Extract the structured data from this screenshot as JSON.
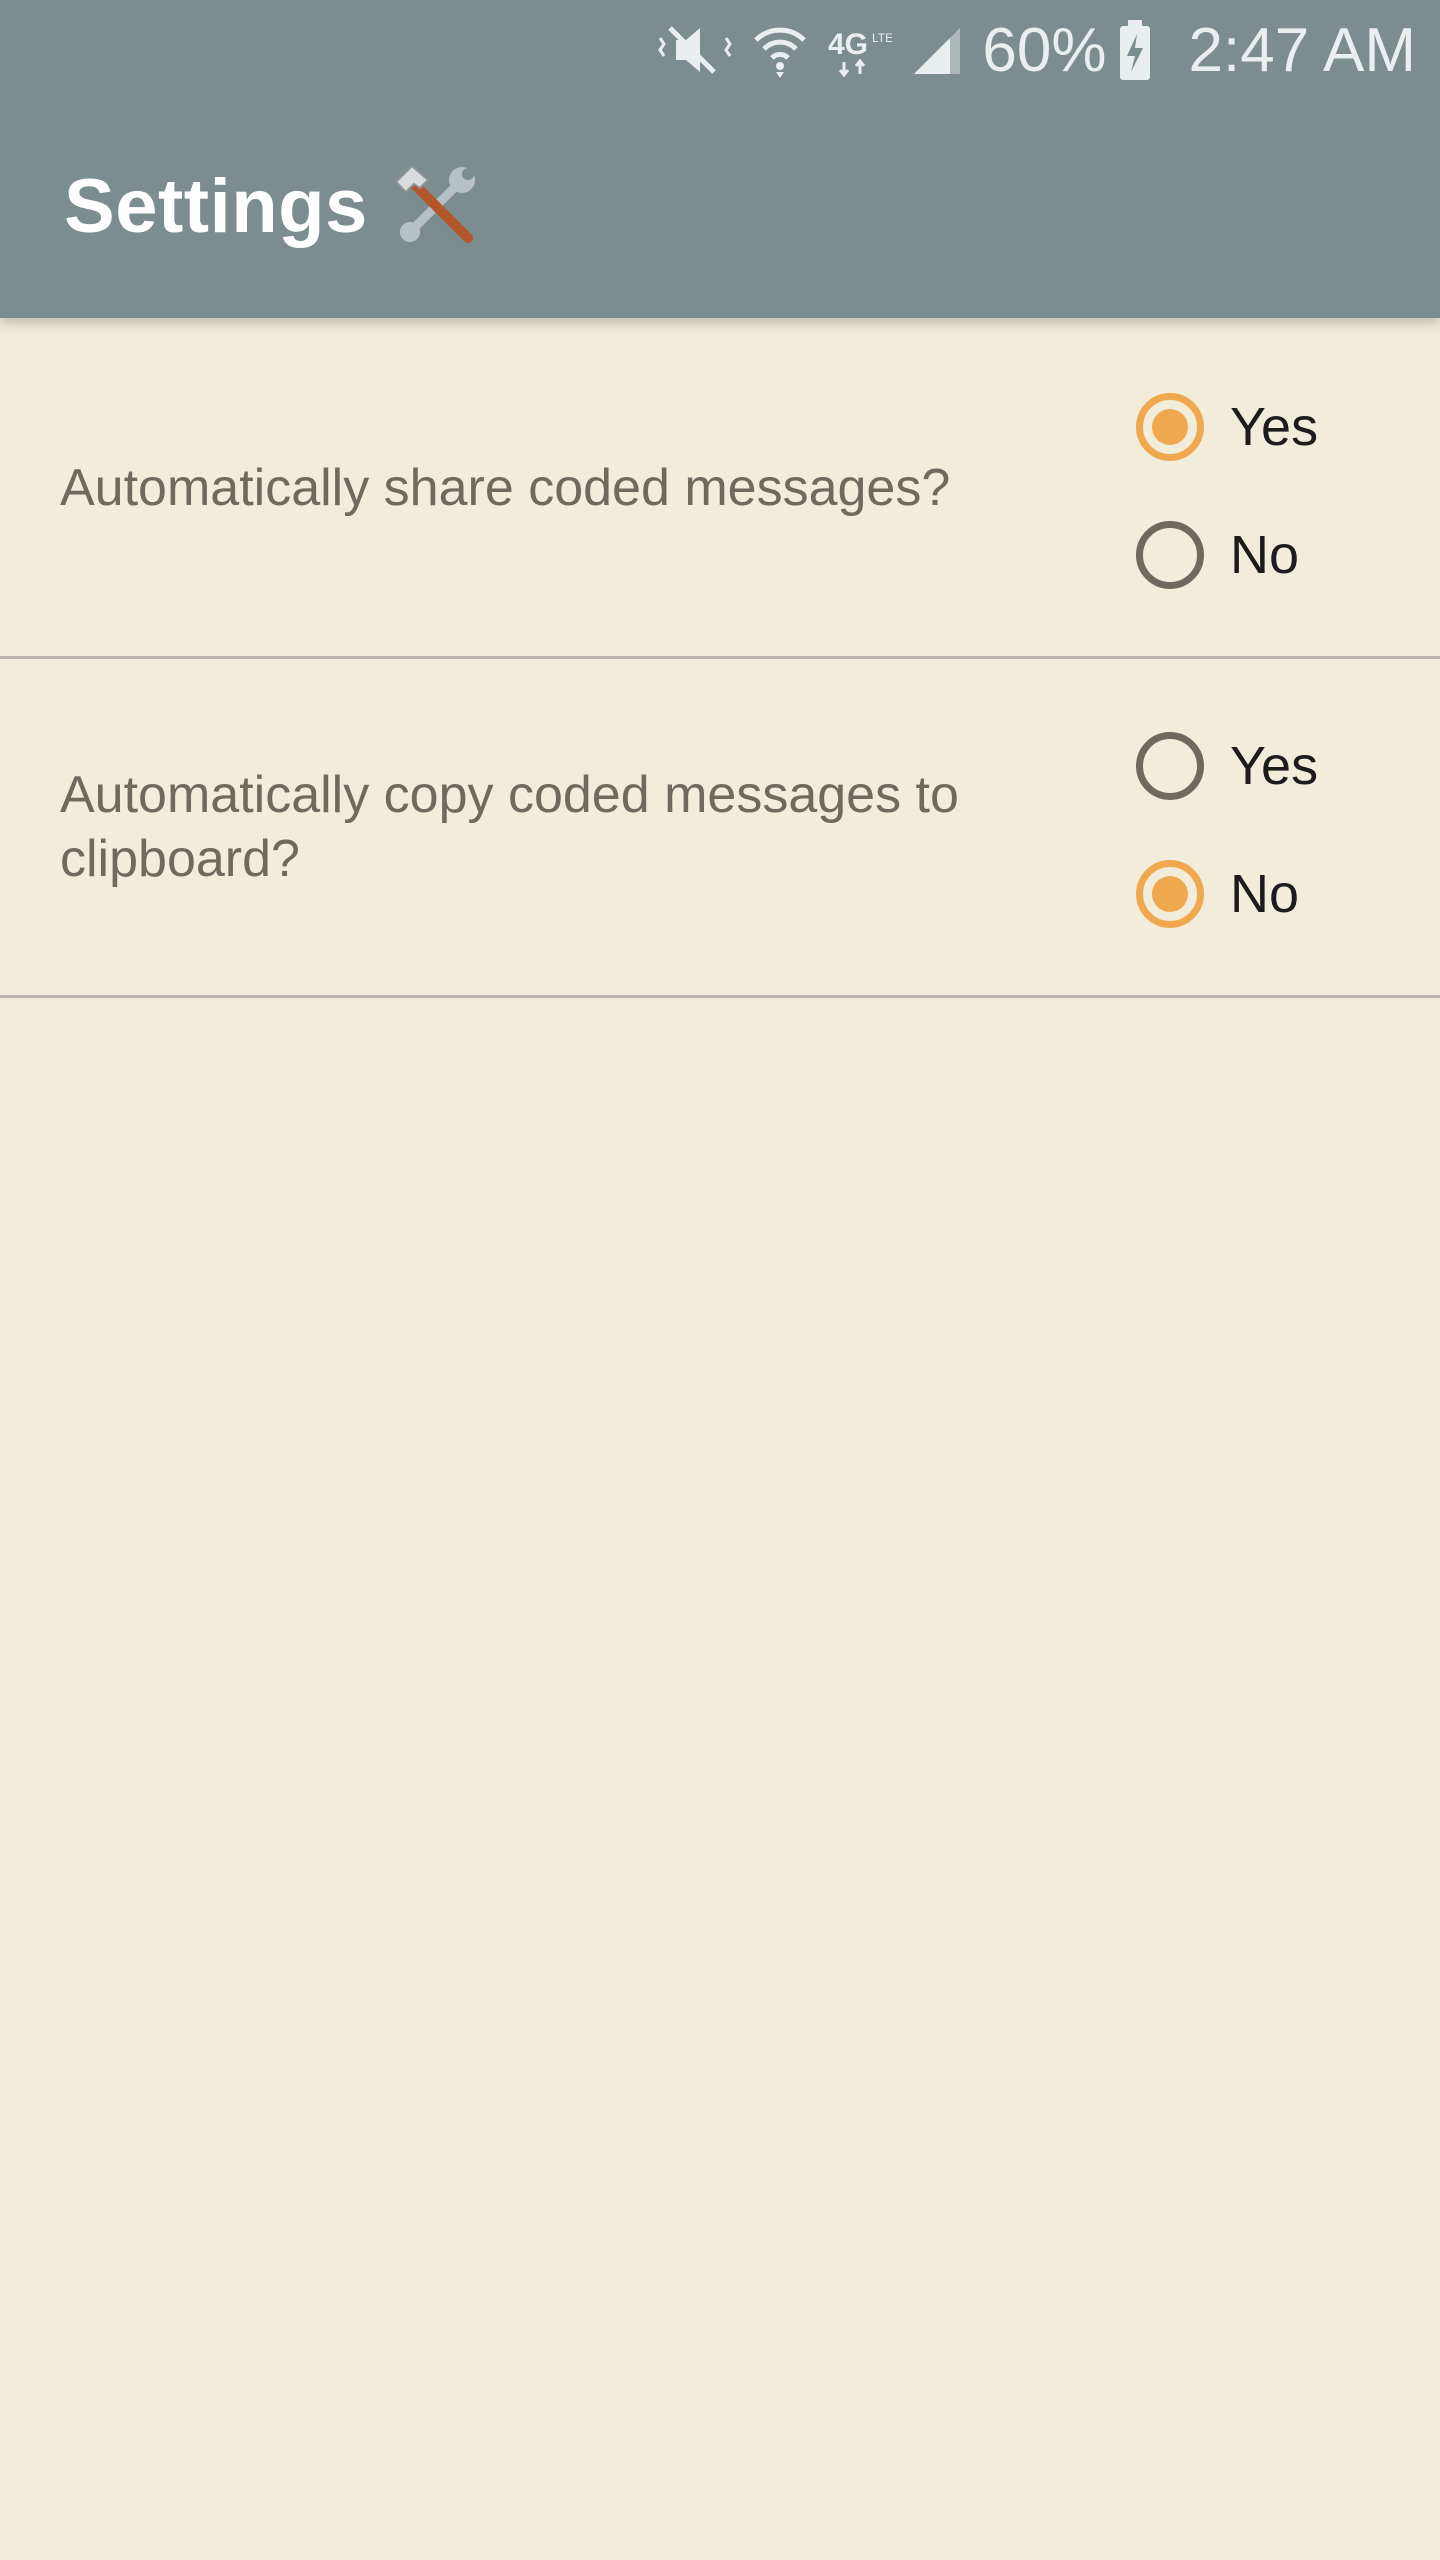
{
  "statusbar": {
    "icons": [
      "mute-vibrate-icon",
      "wifi-icon",
      "4g-lte-icon",
      "cell-signal-icon",
      "battery-charging-icon"
    ],
    "battery_percent": "60%",
    "time": "2:47 AM"
  },
  "appbar": {
    "title": "Settings",
    "title_icon": "hammer-and-wrench-icon",
    "background_color": "#7b8d8f"
  },
  "colors": {
    "background": "#f2ecdb",
    "accent": "#f0a84e",
    "question_text": "#6f6a5e"
  },
  "settings": [
    {
      "question": "Automatically share coded messages?",
      "options": [
        {
          "label": "Yes",
          "selected": true
        },
        {
          "label": "No",
          "selected": false
        }
      ]
    },
    {
      "question": "Automatically copy coded messages to clipboard?",
      "options": [
        {
          "label": "Yes",
          "selected": false
        },
        {
          "label": "No",
          "selected": true
        }
      ]
    }
  ]
}
